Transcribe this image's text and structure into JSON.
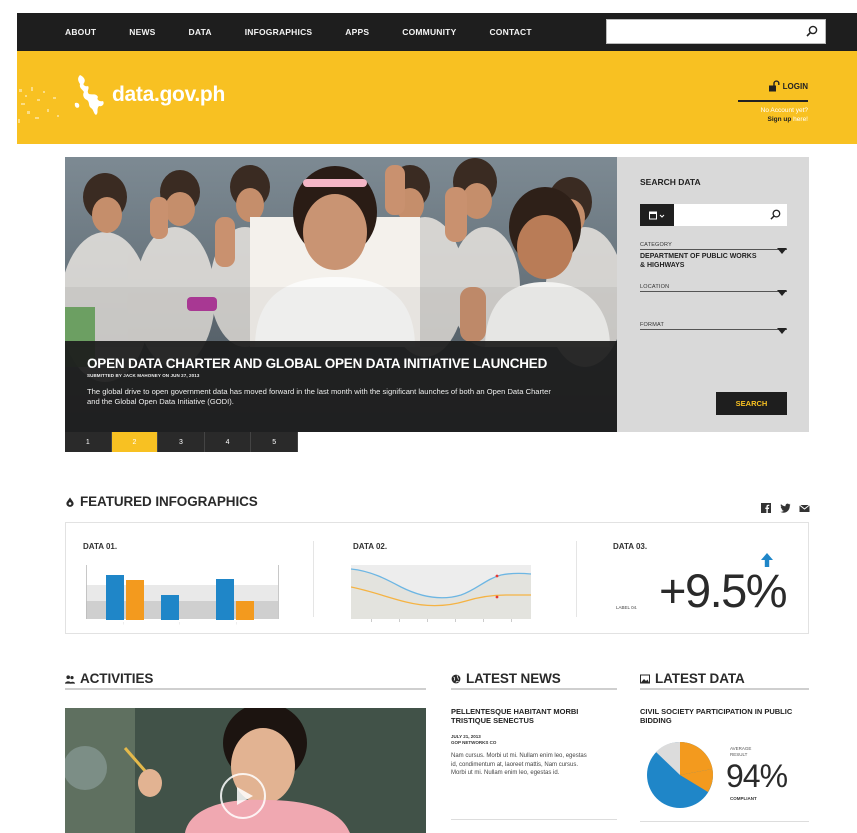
{
  "nav": {
    "items": [
      "ABOUT",
      "NEWS",
      "DATA",
      "INFOGRAPHICS",
      "APPS",
      "COMMUNITY",
      "CONTACT"
    ],
    "search_placeholder": ""
  },
  "header": {
    "logo_text": "data.gov.ph",
    "login_label": "LOGIN",
    "no_account": "No Account yet?",
    "signup_prefix": "Sign up",
    "signup_suffix": "here!"
  },
  "hero": {
    "title": "OPEN DATA CHARTER AND GLOBAL OPEN DATA INITIATIVE LAUNCHED",
    "byline": "SUBMITTED BY JACK MAHONEY ON JUN 27, 2013",
    "summary": "The global drive to open government data has moved forward in the last month with the significant launches of both an Open Data Charter and the Global Open Data Initiative (GODI).",
    "pages": [
      "1",
      "2",
      "3",
      "4",
      "5"
    ],
    "active_page": "2"
  },
  "search_data": {
    "title": "SEARCH DATA",
    "input_placeholder": "",
    "category_label": "CATEGORY",
    "category_value": "DEPARTMENT OF PUBLIC WORKS & HIGHWAYS",
    "location_label": "LOCATION",
    "location_value": "",
    "format_label": "FORMAT",
    "format_value": "",
    "button": "SEARCH"
  },
  "featured": {
    "title": "FEATURED INFOGRAPHICS",
    "data1_title": "DATA 01.",
    "data2_title": "DATA 02.",
    "data3_title": "DATA 03.",
    "data3_value": "+9.5%",
    "data3_label": "LABEL 04."
  },
  "activities": {
    "title": "ACTIVITIES"
  },
  "latest_news": {
    "title": "LATEST NEWS",
    "headline": "PELLENTESQUE HABITANT MORBI TRISTIQUE SENECTUS",
    "date": "JULY 21, 2013",
    "source": "GOP NETWORKS CO",
    "body": "Nam cursus. Morbi ut mi. Nullam enim leo, egestas id, condimentum at, laoreet mattis, Nam cursus. Morbi ut mi. Nullam enim leo, egestas id."
  },
  "latest_data": {
    "title": "LATEST DATA",
    "headline": "CIVIL SOCIETY PARTICIPATION IN PUBLIC BIDDING",
    "avg_label": "AVERAGE RESULT",
    "value": "94%",
    "sub_label": "COMPLIANT"
  },
  "colors": {
    "brand_yellow": "#f8c122",
    "nav_dark": "#1e1e1e",
    "accent_blue": "#1f86c8",
    "accent_orange": "#f39a1e"
  }
}
